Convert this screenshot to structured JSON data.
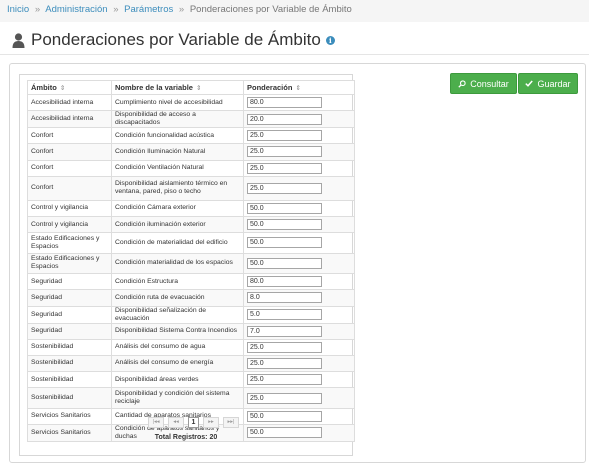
{
  "breadcrumb": {
    "items": [
      "Inicio",
      "Administración",
      "Parámetros"
    ],
    "separator": "»",
    "current": "Ponderaciones por Variable de Ámbito"
  },
  "page": {
    "title": "Ponderaciones por Variable de Ámbito",
    "info_icon": "info-icon",
    "user_icon": "user-icon"
  },
  "toolbar": {
    "consultar_label": "Consultar",
    "consultar_icon": "search-icon",
    "guardar_label": "Guardar",
    "guardar_icon": "check-icon",
    "accent_color": "#4cae4c"
  },
  "table": {
    "columns": [
      "Ámbito",
      "Nombre de la variable",
      "Ponderación"
    ],
    "sort_icon": "sort-icon",
    "rows": [
      {
        "ambito": "Accesibilidad interna",
        "variable": "Cumplimiento nivel de accesibilidad",
        "ponderacion": "80.0"
      },
      {
        "ambito": "Accesibilidad interna",
        "variable": "Disponibilidad de acceso a discapacitados",
        "ponderacion": "20.0"
      },
      {
        "ambito": "Confort",
        "variable": "Condición funcionalidad acústica",
        "ponderacion": "25.0"
      },
      {
        "ambito": "Confort",
        "variable": "Condición Iluminación Natural",
        "ponderacion": "25.0"
      },
      {
        "ambito": "Confort",
        "variable": "Condición Ventilación Natural",
        "ponderacion": "25.0"
      },
      {
        "ambito": "Confort",
        "variable": "Disponibilidad aislamiento térmico en ventana, pared, piso o techo",
        "ponderacion": "25.0"
      },
      {
        "ambito": "Control y vigilancia",
        "variable": "Condición Cámara exterior",
        "ponderacion": "50.0"
      },
      {
        "ambito": "Control y vigilancia",
        "variable": "Condición iluminación exterior",
        "ponderacion": "50.0"
      },
      {
        "ambito": "Estado Edificaciones y Espacios",
        "variable": "Condición de materialidad del edificio",
        "ponderacion": "50.0"
      },
      {
        "ambito": "Estado Edificaciones y Espacios",
        "variable": "Condición materialidad de los espacios",
        "ponderacion": "50.0"
      },
      {
        "ambito": "Seguridad",
        "variable": "Condición Estructura",
        "ponderacion": "80.0"
      },
      {
        "ambito": "Seguridad",
        "variable": "Condición ruta de evacuación",
        "ponderacion": "8.0"
      },
      {
        "ambito": "Seguridad",
        "variable": "Disponibilidad señalización de evacuación",
        "ponderacion": "5.0"
      },
      {
        "ambito": "Seguridad",
        "variable": "Disponibilidad Sistema Contra Incendios",
        "ponderacion": "7.0"
      },
      {
        "ambito": "Sostenibilidad",
        "variable": "Análisis del consumo de agua",
        "ponderacion": "25.0"
      },
      {
        "ambito": "Sostenibilidad",
        "variable": "Análisis del consumo de energía",
        "ponderacion": "25.0"
      },
      {
        "ambito": "Sostenibilidad",
        "variable": "Disponibilidad áreas verdes",
        "ponderacion": "25.0"
      },
      {
        "ambito": "Sostenibilidad",
        "variable": "Disponibilidad y condición del sistema reciclaje",
        "ponderacion": "25.0"
      },
      {
        "ambito": "Servicios Sanitarios",
        "variable": "Cantidad de aparatos sanitarios",
        "ponderacion": "50.0"
      },
      {
        "ambito": "Servicios Sanitarios",
        "variable": "Condición de aparatos sanitarios y duchas",
        "ponderacion": "50.0"
      }
    ]
  },
  "pager": {
    "first": "|◂◂",
    "prev": "◂◂",
    "current_page": "1",
    "next": "▸▸",
    "last": "▸▸|"
  },
  "footer": {
    "total_text": "Total Registros: 20"
  }
}
